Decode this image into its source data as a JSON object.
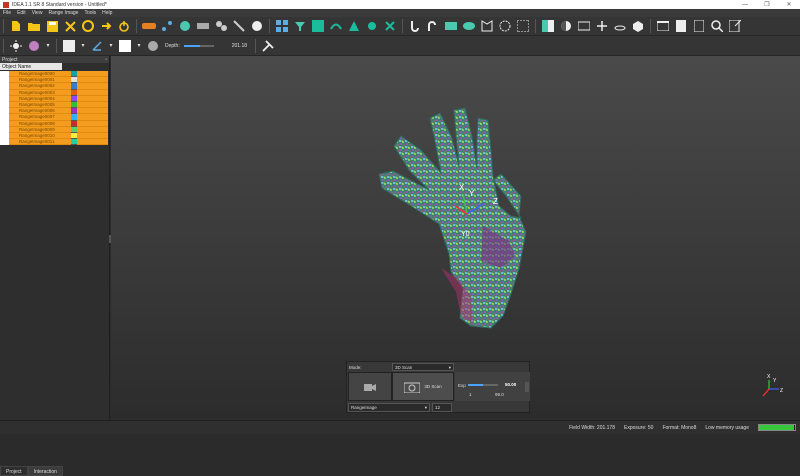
{
  "window": {
    "title": "IDEA 1.1 SR 8 Standard version - Untitled*",
    "min": "—",
    "max": "❐",
    "close": "✕"
  },
  "menu": [
    "File",
    "Edit",
    "View",
    "Range Image",
    "Tools",
    "Help"
  ],
  "toolbar2": {
    "depth_label": "Depth:",
    "depth_value": "201.18"
  },
  "project": {
    "title": "Project",
    "column": "Object Name",
    "items": [
      {
        "name": "RangeImage0000",
        "color": "#1aa0a0"
      },
      {
        "name": "RangeImage0001",
        "color": "#e0e0e0"
      },
      {
        "name": "RangeImage0002",
        "color": "#3a7ad0"
      },
      {
        "name": "RangeImage0003",
        "color": "#e06010"
      },
      {
        "name": "RangeImage0004",
        "color": "#8a4aff"
      },
      {
        "name": "RangeImage0005",
        "color": "#34c034"
      },
      {
        "name": "RangeImage0006",
        "color": "#9a30c0"
      },
      {
        "name": "RangeImage0007",
        "color": "#30b0ff"
      },
      {
        "name": "RangeImage0008",
        "color": "#c03030"
      },
      {
        "name": "RangeImage0009",
        "color": "#60d060"
      },
      {
        "name": "RangeImage0010",
        "color": "#f0f040"
      },
      {
        "name": "RangeImage0011",
        "color": "#20d0a0"
      }
    ],
    "tabs": [
      "Project",
      "Interaction"
    ]
  },
  "viewport": {
    "axis_x": "X",
    "axis_y": "Y",
    "axis_z": "Z",
    "model_label": "Y0"
  },
  "scan": {
    "mode_label": "Mode:",
    "mode_value": "3D Scan",
    "scan_button": "3D Scan",
    "exp_label": "Exp",
    "exp_value": "50.00",
    "exp_min": "1",
    "exp_max": "99.0",
    "exp_level": 0.5,
    "source": "RangeImage",
    "source_num": "12"
  },
  "status": {
    "field_width": "Field Width: 201.178",
    "exposure": "Exposure: 50",
    "format": "Format: Mono8",
    "memory": "Low memory usage",
    "memory_level": 0.97
  },
  "colors": {
    "accent": "#4aa3ff",
    "orange": "#f39c1e"
  }
}
